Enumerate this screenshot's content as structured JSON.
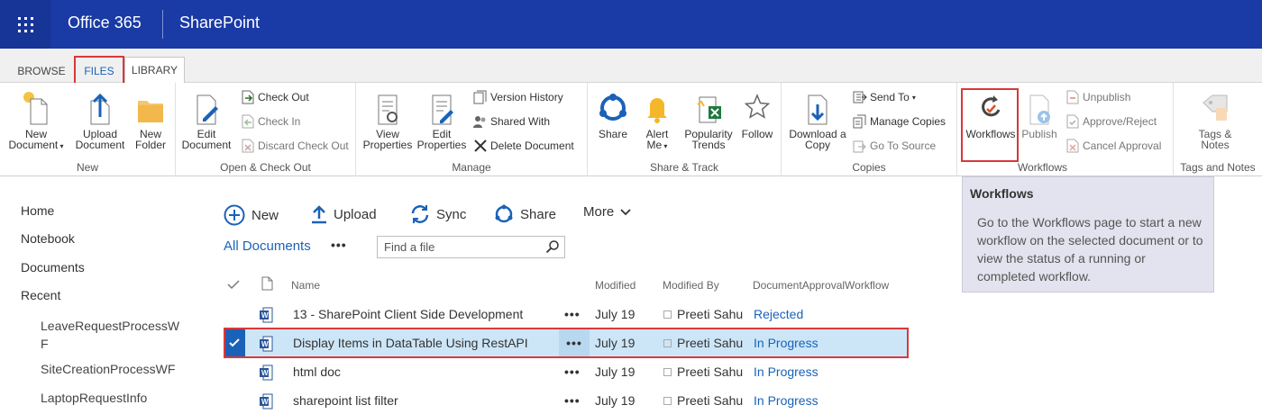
{
  "suite": {
    "brand": "Office 365",
    "site": "SharePoint"
  },
  "tabs": {
    "browse": "BROWSE",
    "files": "FILES",
    "library": "LIBRARY"
  },
  "ribbon": {
    "new": {
      "new_document": "New\nDocument",
      "upload_document": "Upload\nDocument",
      "new_folder": "New\nFolder",
      "label": "New"
    },
    "open": {
      "edit_document": "Edit\nDocument",
      "check_out": "Check Out",
      "check_in": "Check In",
      "discard": "Discard Check Out",
      "label": "Open & Check Out"
    },
    "manage": {
      "view_properties": "View\nProperties",
      "edit_properties": "Edit\nProperties",
      "version_history": "Version History",
      "shared_with": "Shared With",
      "delete_document": "Delete Document",
      "label": "Manage"
    },
    "share": {
      "share": "Share",
      "alert_me": "Alert\nMe",
      "popularity": "Popularity\nTrends",
      "follow": "Follow",
      "label": "Share & Track"
    },
    "copies": {
      "download": "Download a\nCopy",
      "send_to": "Send To",
      "manage_copies": "Manage Copies",
      "go_to_source": "Go To Source",
      "label": "Copies"
    },
    "workflows": {
      "workflows": "Workflows",
      "publish": "Publish",
      "unpublish": "Unpublish",
      "approve_reject": "Approve/Reject",
      "cancel_approval": "Cancel Approval",
      "label": "Workflows"
    },
    "tags": {
      "tags_notes": "Tags &\nNotes",
      "label": "Tags and Notes"
    }
  },
  "tooltip": {
    "title": "Workflows",
    "body": "Go to the Workflows page to start a new workflow on the selected document or to view the status of a running or completed workflow."
  },
  "leftnav": [
    "Home",
    "Notebook",
    "Documents",
    "Recent"
  ],
  "recent": [
    "LeaveRequestProcessW\nF",
    "SiteCreationProcessWF",
    "LaptopRequestInfo"
  ],
  "commands": {
    "new": "New",
    "upload": "Upload",
    "sync": "Sync",
    "share": "Share",
    "more": "More"
  },
  "view": {
    "name": "All Documents",
    "search_placeholder": "Find a file"
  },
  "columns": {
    "name": "Name",
    "modified": "Modified",
    "modified_by": "Modified By",
    "workflow": "DocumentApprovalWorkflow"
  },
  "rows": [
    {
      "name": "13 - SharePoint Client Side Development",
      "modified": "July 19",
      "modified_by": "Preeti Sahu",
      "status": "Rejected"
    },
    {
      "name": "Display Items in DataTable Using RestAPI",
      "modified": "July 19",
      "modified_by": "Preeti Sahu",
      "status": "In Progress"
    },
    {
      "name": "html doc",
      "modified": "July 19",
      "modified_by": "Preeti Sahu",
      "status": "In Progress"
    },
    {
      "name": "sharepoint list filter",
      "modified": "July 19",
      "modified_by": "Preeti Sahu",
      "status": "In Progress"
    }
  ],
  "colors": {
    "suite": "#1a3aa5",
    "accent": "#1a62b8",
    "highlight": "#d8393b",
    "selected_row": "#cde6f7"
  }
}
